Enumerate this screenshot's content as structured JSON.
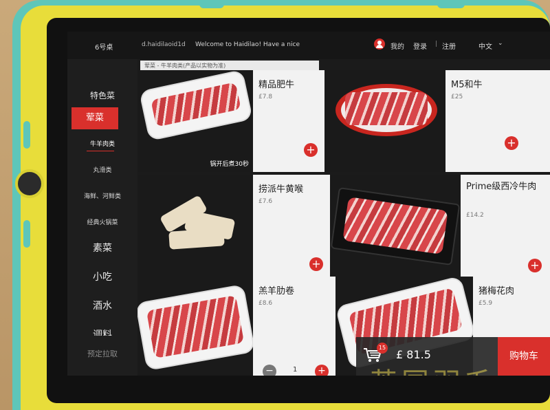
{
  "topbar": {
    "table_no": "6号桌",
    "user_id": "d.haidilaoid1d",
    "welcome": "Welcome to Haidilao! Have a nice",
    "my": "我的",
    "login": "登录",
    "separator": "|",
    "register": "注册",
    "language": "中文",
    "language_chevron": "⌄"
  },
  "breadcrumb": "荤菜 - 牛羊肉类(产品以实物为准)",
  "sidebar": {
    "items": [
      {
        "label": "特色菜"
      },
      {
        "label": "荤菜"
      },
      {
        "label": "牛羊肉类"
      },
      {
        "label": "丸滑类"
      },
      {
        "label": "海鲜、河鲜类"
      },
      {
        "label": "经典火锅菜"
      },
      {
        "label": "素菜"
      },
      {
        "label": "小吃"
      },
      {
        "label": "酒水"
      },
      {
        "label": "调料"
      }
    ],
    "reserve": "预定拉取"
  },
  "products": [
    {
      "name": "精品肥牛",
      "price": "£7.8",
      "caption": "锅开后煮30秒"
    },
    {
      "name": "M5和牛",
      "price": "£25"
    },
    {
      "name": "捞派牛黄喉",
      "price": "£7.6"
    },
    {
      "name": "Prime级西冷牛肉",
      "price": "£14.2"
    },
    {
      "name": "羔羊肋卷",
      "price": "£8.6"
    },
    {
      "name": "猪梅花肉",
      "price": "£5.9"
    }
  ],
  "add_symbol": "+",
  "cart": {
    "badge": "15",
    "total": "£  81.5",
    "button": "购物车"
  },
  "stepper": {
    "minus": "−",
    "qty": "1",
    "plus": "+"
  },
  "watermark": "英国羽毛",
  "colors": {
    "accent": "#d9302c",
    "case_yellow": "#e8dd3a",
    "case_teal": "#5ec6b9"
  },
  "icons": [
    "person-icon",
    "cart-icon",
    "plus-icon",
    "minus-icon",
    "chevron-down-icon"
  ]
}
